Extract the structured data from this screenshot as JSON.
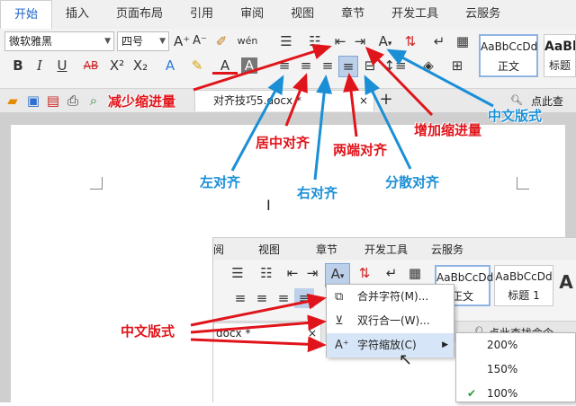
{
  "menu": [
    "开始",
    "插入",
    "页面布局",
    "引用",
    "审阅",
    "视图",
    "章节",
    "开发工具",
    "云服务"
  ],
  "font": {
    "name": "微软雅黑",
    "size": "四号"
  },
  "styles": {
    "preview": "AaBbCcDd",
    "normal": "正文",
    "heading": "标题"
  },
  "tab": {
    "file": "对齐技巧5.docx *",
    "search": "点此查"
  },
  "labels": {
    "decrease_indent": "减少缩进量",
    "center": "居中对齐",
    "justify": "两端对齐",
    "increase_indent": "增加缩进量",
    "chinese_layout": "中文版式",
    "left": "左对齐",
    "right": "右对齐",
    "distribute": "分散对齐",
    "chinese_layout2": "中文版式"
  },
  "inset": {
    "menu": [
      "视图",
      "章节",
      "开发工具",
      "云服务"
    ],
    "menu_partial": "阅",
    "tab_file": "docx *",
    "search": "点此查找命令",
    "styles": {
      "preview": "AaBbCcDd",
      "normal": "正文",
      "heading": "标题 1"
    },
    "dropdown": [
      "合并字符(M)...",
      "双行合一(W)...",
      "字符缩放(C)"
    ],
    "submenu": [
      "200%",
      "150%",
      "100%"
    ]
  },
  "colors": {
    "red": "#e0151b",
    "blue": "#1a8fd6",
    "accent": "#1f62c7"
  }
}
